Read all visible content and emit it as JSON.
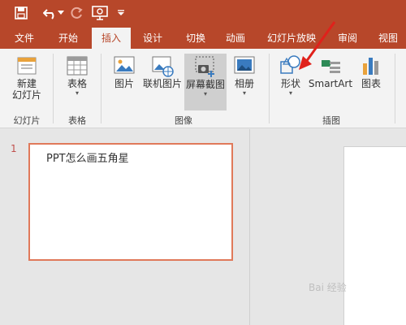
{
  "quick_access": {
    "icons": [
      "save-icon",
      "undo-icon",
      "redo-icon",
      "slideshow-icon",
      "customize-icon"
    ]
  },
  "tabs": [
    "文件",
    "开始",
    "插入",
    "设计",
    "切换",
    "动画",
    "幻灯片放映",
    "审阅",
    "视图"
  ],
  "active_tab": "插入",
  "ribbon": {
    "new_slide": "新建",
    "new_slide_line2": "幻灯片",
    "group_slides": "幻灯片",
    "table": "表格",
    "group_tables": "表格",
    "pictures": "图片",
    "online_pictures": "联机图片",
    "screenshot": "屏幕截图",
    "album": "相册",
    "group_images": "图像",
    "shapes": "形状",
    "smartart": "SmartArt",
    "chart": "图表",
    "group_illustrations": "插图"
  },
  "thumbnails": [
    {
      "number": "1",
      "text": "PPT怎么画五角星"
    }
  ],
  "watermark": "Bai 经验"
}
